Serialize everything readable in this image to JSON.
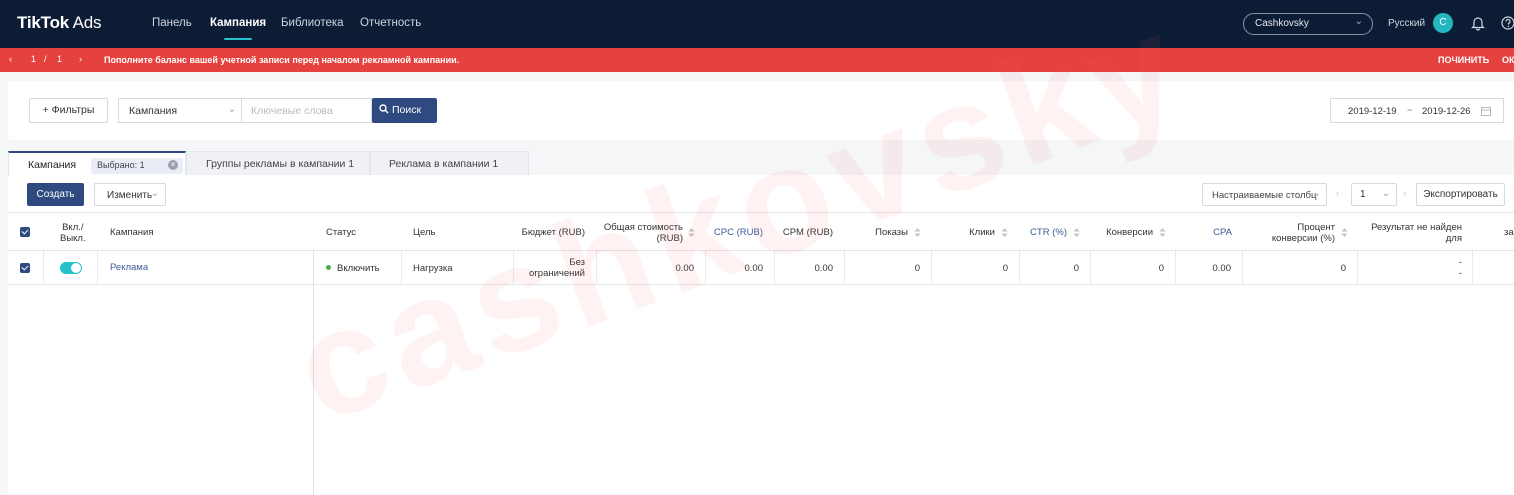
{
  "topbar": {
    "logo_bold": "TikTok",
    "logo_light": "Ads",
    "nav": [
      "Панель",
      "Кампания",
      "Библиотека",
      "Отчетность"
    ],
    "account": "Cashkovsky",
    "language": "Русский",
    "avatar_letter": "C"
  },
  "alert": {
    "pager_current": "1",
    "pager_sep": "/",
    "pager_total": "1",
    "message": "Пополните баланс вашей учетной записи перед началом рекламной кампании.",
    "fix_label": "ПОЧИНИТЬ",
    "ok_label": "ОК"
  },
  "filters": {
    "filters_button": "+ Фильтры",
    "scope_select": "Кампания",
    "keywords_placeholder": "Ключевые слова",
    "search_button": "Поиск",
    "date_from": "2019-12-19",
    "date_sep": "~",
    "date_to": "2019-12-26"
  },
  "tabs": {
    "campaign": "Кампания",
    "selected_chip": "Выбрано: 1",
    "ad_groups": "Группы рекламы в кампании 1",
    "ads": "Реклама в кампании 1"
  },
  "toolbar": {
    "create": "Создать",
    "edit": "Изменить",
    "custom_columns": "Настраиваемые столбц",
    "page": "1",
    "export": "Экспортировать"
  },
  "table": {
    "headers": {
      "toggle_1": "Вкл./",
      "toggle_2": "Выкл.",
      "campaign": "Кампания",
      "status": "Статус",
      "goal": "Цель",
      "budget": "Бюджет (RUB)",
      "total_cost_1": "Общая стоимость",
      "total_cost_2": "(RUB)",
      "cpc": "CPC (RUB)",
      "cpm": "CPM (RUB)",
      "impressions": "Показы",
      "clicks": "Клики",
      "ctr": "CTR (%)",
      "conversions": "Конверсии",
      "cpa": "CPA",
      "conv_rate_1": "Процент",
      "conv_rate_2": "конверсии (%)",
      "result_1": "Результат не найден",
      "result_2": "для",
      "cut": "за"
    },
    "row": {
      "campaign": "Реклама",
      "status": "Включить",
      "goal": "Нагрузка",
      "budget_1": "Без",
      "budget_2": "ограничений",
      "total_cost": "0.00",
      "cpc": "0.00",
      "cpm": "0.00",
      "impressions": "0",
      "clicks": "0",
      "ctr": "0",
      "conversions": "0",
      "cpa": "0.00",
      "conv_rate": "0",
      "result_1": "-",
      "result_2": "-"
    }
  },
  "watermark": "cashkovsky",
  "colors": {
    "topbar": "#0d1c35",
    "alert": "#e5423f",
    "primary": "#2e4a80",
    "accent": "#25c2c9"
  }
}
